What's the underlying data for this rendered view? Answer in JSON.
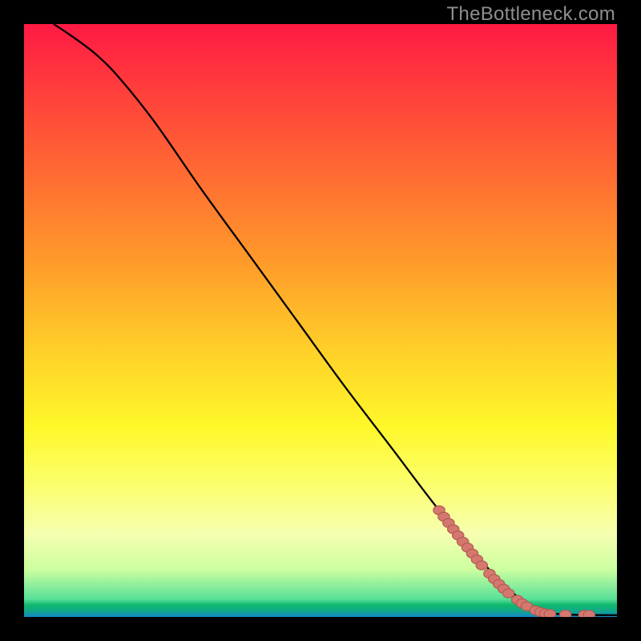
{
  "watermark": "TheBottleneck.com",
  "colors": {
    "dot_fill": "#d4786f",
    "dot_stroke": "#b55b52",
    "curve": "#000000",
    "background": "#000000"
  },
  "chart_data": {
    "type": "line",
    "title": "",
    "xlabel": "",
    "ylabel": "",
    "xlim": [
      0,
      100
    ],
    "ylim": [
      0,
      100
    ],
    "grid": false,
    "curve": [
      {
        "x": 5,
        "y": 100
      },
      {
        "x": 8,
        "y": 98
      },
      {
        "x": 12,
        "y": 95
      },
      {
        "x": 16,
        "y": 91
      },
      {
        "x": 22,
        "y": 83.5
      },
      {
        "x": 30,
        "y": 72
      },
      {
        "x": 38,
        "y": 61
      },
      {
        "x": 46,
        "y": 50
      },
      {
        "x": 54,
        "y": 39
      },
      {
        "x": 62,
        "y": 28.5
      },
      {
        "x": 70,
        "y": 18
      },
      {
        "x": 78,
        "y": 8.5
      },
      {
        "x": 82,
        "y": 4.5
      },
      {
        "x": 85,
        "y": 2
      },
      {
        "x": 88,
        "y": 0.8
      },
      {
        "x": 92,
        "y": 0.4
      },
      {
        "x": 100,
        "y": 0.3
      }
    ],
    "dots": [
      {
        "x": 70.0,
        "y": 18.0
      },
      {
        "x": 70.8,
        "y": 16.9
      },
      {
        "x": 71.6,
        "y": 15.85
      },
      {
        "x": 72.4,
        "y": 14.8
      },
      {
        "x": 73.2,
        "y": 13.75
      },
      {
        "x": 74.0,
        "y": 12.7
      },
      {
        "x": 74.8,
        "y": 11.7
      },
      {
        "x": 75.6,
        "y": 10.7
      },
      {
        "x": 76.4,
        "y": 9.7
      },
      {
        "x": 77.2,
        "y": 8.7
      },
      {
        "x": 78.5,
        "y": 7.3
      },
      {
        "x": 79.3,
        "y": 6.4
      },
      {
        "x": 80.1,
        "y": 5.55
      },
      {
        "x": 80.9,
        "y": 4.75
      },
      {
        "x": 81.7,
        "y": 4.0
      },
      {
        "x": 83.2,
        "y": 2.9
      },
      {
        "x": 84.0,
        "y": 2.3
      },
      {
        "x": 84.8,
        "y": 1.8
      },
      {
        "x": 86.3,
        "y": 1.1
      },
      {
        "x": 87.1,
        "y": 0.82
      },
      {
        "x": 87.9,
        "y": 0.6
      },
      {
        "x": 88.7,
        "y": 0.5
      },
      {
        "x": 91.3,
        "y": 0.4
      },
      {
        "x": 94.5,
        "y": 0.35
      },
      {
        "x": 95.3,
        "y": 0.35
      }
    ]
  }
}
